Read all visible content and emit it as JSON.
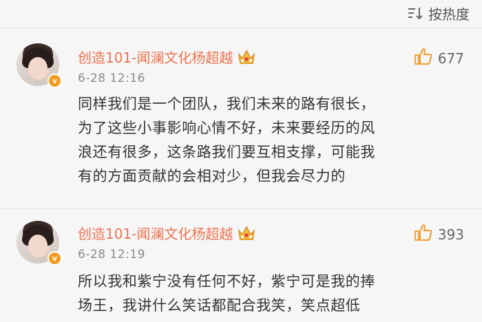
{
  "sort": {
    "label": "按热度",
    "icon": "sort-icon"
  },
  "comments": [
    {
      "author": "创造101-闻澜文化杨超越",
      "badge_icon": "crown-badge-icon",
      "verified_icon": "verified-v-icon",
      "time": "6-28 12:16",
      "likes": "677",
      "lines": [
        "同样我们是一个团队，我们未来的路有很长，",
        "为了这些小事影响心情不好，未来要经历的风",
        "浪还有很多，这条路我们要互相支撑，可能我",
        "有的方面贡献的会相对少，但我会尽力的"
      ]
    },
    {
      "author": "创造101-闻澜文化杨超越",
      "badge_icon": "crown-badge-icon",
      "verified_icon": "verified-v-icon",
      "time": "6-28 12:19",
      "likes": "393",
      "lines": [
        "所以我和紫宁没有任何不好，紫宁可是我的捧",
        "场王，我讲什么笑话都配合我笑，笑点超低"
      ]
    }
  ],
  "colors": {
    "author": "#eb7350",
    "like_icon": "#f0a23a",
    "text": "#333333"
  }
}
